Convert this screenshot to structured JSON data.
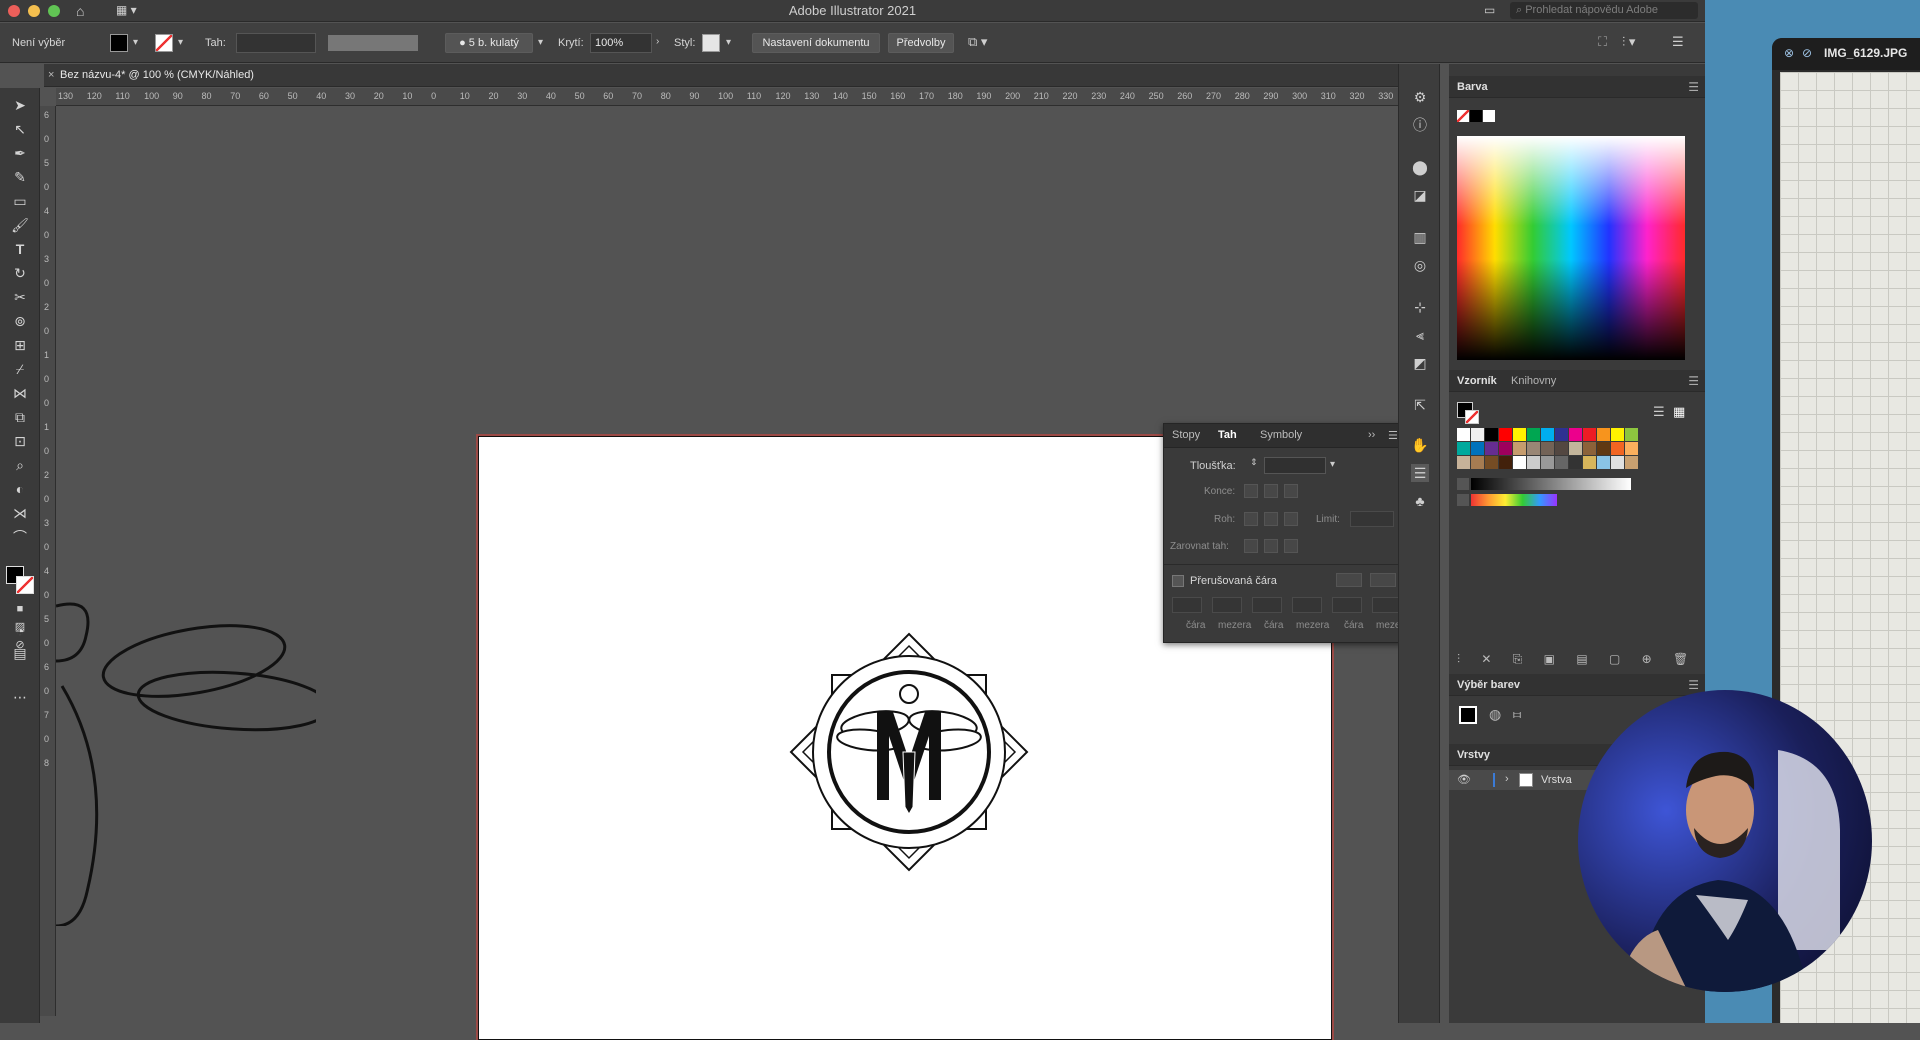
{
  "window": {
    "title": "Adobe Illustrator 2021",
    "search_placeholder": "Prohledat nápovědu Adobe"
  },
  "controlbar": {
    "selection_label": "Není výběr",
    "stroke_label": "Tah:",
    "brush_label": "5 b. kulatý",
    "opacity_label": "Krytí:",
    "opacity_value": "100%",
    "style_label": "Styl:",
    "doc_setup_button": "Nastavení dokumentu",
    "prefs_button": "Předvolby"
  },
  "document": {
    "tab_label": "Bez názvu-4* @ 100 % (CMYK/Náhled)",
    "close_glyph": "×"
  },
  "ruler": {
    "h_ticks": [
      "130",
      "120",
      "110",
      "100",
      "90",
      "80",
      "70",
      "60",
      "50",
      "40",
      "30",
      "20",
      "10",
      "0",
      "10",
      "20",
      "30",
      "40",
      "50",
      "60",
      "70",
      "80",
      "90",
      "100",
      "110",
      "120",
      "130",
      "140",
      "150",
      "160",
      "170",
      "180",
      "190",
      "200",
      "210",
      "220",
      "230",
      "240",
      "250",
      "260",
      "270",
      "280",
      "290",
      "300",
      "310",
      "320",
      "330"
    ],
    "v_ticks": [
      "6",
      "0",
      "5",
      "0",
      "4",
      "0",
      "3",
      "0",
      "2",
      "0",
      "1",
      "0",
      "0",
      "1",
      "0",
      "2",
      "0",
      "3",
      "0",
      "4",
      "0",
      "5",
      "0",
      "6",
      "0",
      "7",
      "0",
      "8"
    ]
  },
  "stroke_panel": {
    "tabs": [
      "Stopy",
      "Tah",
      "Symboly"
    ],
    "weight_label": "Tloušťka:",
    "cap_label": "Konce:",
    "corner_label": "Roh:",
    "limit_label": "Limit:",
    "align_label": "Zarovnat tah:",
    "dashed_label": "Přerušovaná čára",
    "dash_labels": [
      "čára",
      "mezera",
      "čára",
      "mezera",
      "čára",
      "mezera"
    ]
  },
  "panels": {
    "color_title": "Barva",
    "swatches_tab": "Vzorník",
    "libraries_tab": "Knihovny",
    "color_guide_title": "Výběr barev",
    "layers_title": "Vrstvy",
    "layer_name": "Vrstva"
  },
  "photo_window": {
    "title": "IMG_6129.JPG"
  },
  "colors": {
    "accent_artboard": "#9b4a46",
    "panel_bg": "#3a3a3a"
  },
  "swatch_rows": [
    [
      "#ffffff",
      "#f0f0f0",
      "#000000",
      "#ff0000",
      "#fff200",
      "#00a651",
      "#00aeef",
      "#2e3192",
      "#ec008c",
      "#ed1c24",
      "#f7941d",
      "#fff200",
      "#8dc63f"
    ],
    [
      "#00a99d",
      "#0072bc",
      "#662d91",
      "#9e005d",
      "#c69c6d",
      "#998675",
      "#736357",
      "#534741",
      "#c2b59b",
      "#8c6239",
      "#603913",
      "#f26522",
      "#fbaf5d"
    ],
    [
      "#c7b299",
      "#a67c52",
      "#754c24",
      "#42210b",
      "#ffffff",
      "#cccccc",
      "#999999",
      "#666666",
      "#333333",
      "#d7b55b",
      "#8ac4e6",
      "#e0e0e0",
      "#c9a070"
    ]
  ]
}
